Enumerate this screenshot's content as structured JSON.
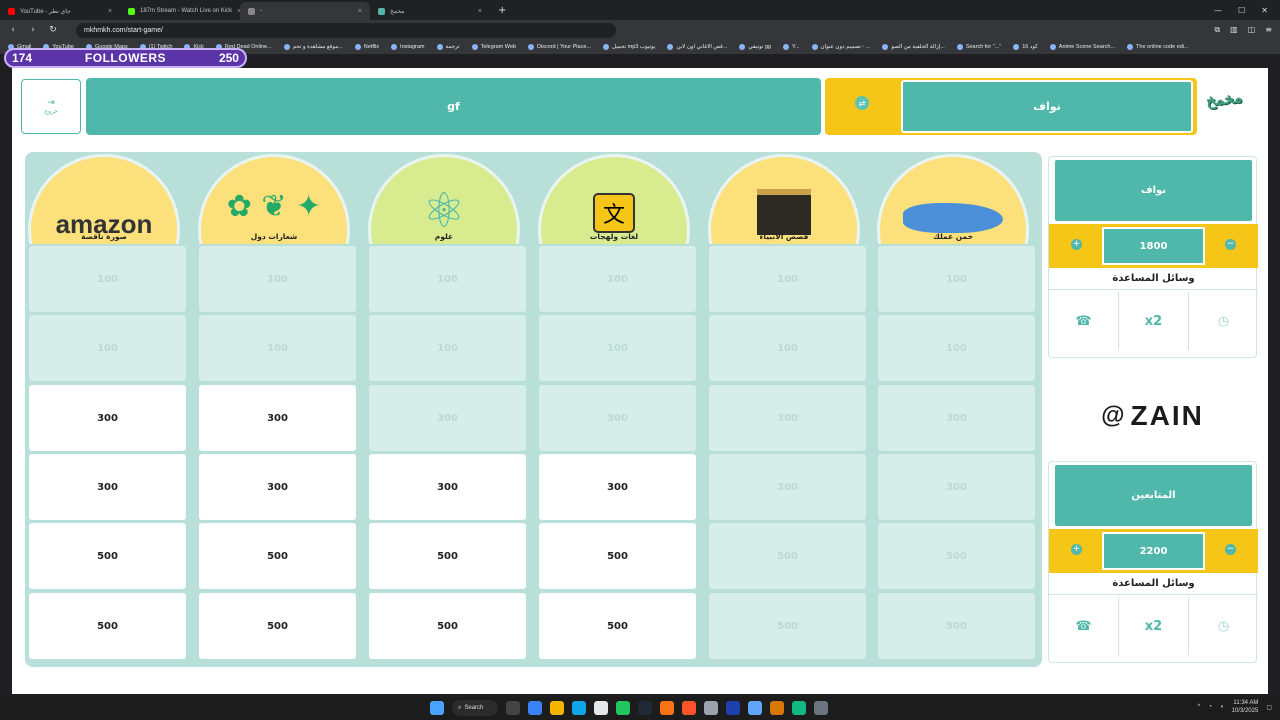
{
  "browser": {
    "tabs": [
      {
        "title": "YouTube - جاي نطر",
        "color": "#ff0000",
        "active": false
      },
      {
        "title": "187m Stream - Watch Live on Kick",
        "color": "#53fc18",
        "active": false
      },
      {
        "title": "-",
        "color": "#888888",
        "active": true
      },
      {
        "title": "مخمخ",
        "color": "#4fb8aa",
        "active": false
      }
    ],
    "url": "mkhmkh.com/start-game/",
    "bookmarks": [
      "Gmail",
      "YouTube",
      "Google Maps",
      "(1) Twitch",
      "Kick",
      "Red Dead Online...",
      "موقع مشاهدة و تحم...",
      "Netflix",
      "Instagram",
      "ترجمة",
      "Telegram Web",
      "Discord | Your Place...",
      "تحميل mp3 يوتيوب",
      "قص الاغاني اون لاين...",
      "توتيقي gg",
      "Y...",
      "تصميم دون عنوان - ...",
      "إزالة الخلفية من الصو...",
      "Search for \"...\"",
      "كود 16",
      "Anime Scene Search...",
      "The online code edi..."
    ]
  },
  "overlay": {
    "left": "174",
    "label": "FOLLOWERS",
    "right": "250"
  },
  "header": {
    "exit_label": "خروج",
    "team_bar": "gf",
    "current_turn": "نواف",
    "logo": "مخمخ"
  },
  "categories": [
    {
      "name": "صورة ناقصة",
      "art": "amazon",
      "cells": [
        {
          "value": "100",
          "active": false
        },
        {
          "value": "100",
          "active": false
        },
        {
          "value": "300",
          "active": true
        },
        {
          "value": "300",
          "active": true
        },
        {
          "value": "500",
          "active": true
        },
        {
          "value": "500",
          "active": true
        }
      ]
    },
    {
      "name": "شعارات دول",
      "art": "flags",
      "cells": [
        {
          "value": "100",
          "active": false
        },
        {
          "value": "100",
          "active": false
        },
        {
          "value": "300",
          "active": true
        },
        {
          "value": "300",
          "active": true
        },
        {
          "value": "500",
          "active": true
        },
        {
          "value": "500",
          "active": true
        }
      ]
    },
    {
      "name": "علوم",
      "art": "atom",
      "cells": [
        {
          "value": "100",
          "active": false
        },
        {
          "value": "100",
          "active": false
        },
        {
          "value": "300",
          "active": false
        },
        {
          "value": "300",
          "active": true
        },
        {
          "value": "500",
          "active": true
        },
        {
          "value": "500",
          "active": true
        }
      ]
    },
    {
      "name": "لغات ولهجات",
      "art": "language",
      "cells": [
        {
          "value": "100",
          "active": false
        },
        {
          "value": "100",
          "active": false
        },
        {
          "value": "300",
          "active": false
        },
        {
          "value": "300",
          "active": true
        },
        {
          "value": "500",
          "active": true
        },
        {
          "value": "500",
          "active": true
        }
      ]
    },
    {
      "name": "قصص الانبياء",
      "art": "kaaba",
      "cells": [
        {
          "value": "100",
          "active": false
        },
        {
          "value": "100",
          "active": false
        },
        {
          "value": "300",
          "active": false
        },
        {
          "value": "300",
          "active": false
        },
        {
          "value": "500",
          "active": false
        },
        {
          "value": "500",
          "active": false
        }
      ]
    },
    {
      "name": "خمن عملك",
      "art": "map",
      "cells": [
        {
          "value": "100",
          "active": false
        },
        {
          "value": "100",
          "active": false
        },
        {
          "value": "300",
          "active": false
        },
        {
          "value": "300",
          "active": false
        },
        {
          "value": "500",
          "active": false
        },
        {
          "value": "500",
          "active": false
        }
      ]
    }
  ],
  "teams": [
    {
      "name": "نواف",
      "score": "1800",
      "help_title": "وسائل المساعدة",
      "help": [
        "call-friend-icon",
        "double-points-icon",
        "timer-icon"
      ],
      "help_text": [
        "",
        "x2",
        ""
      ]
    },
    {
      "name": "المتابعين",
      "score": "2200",
      "help_title": "وسائل المساعدة",
      "help": [
        "call-friend-icon",
        "double-points-icon",
        "timer-icon"
      ],
      "help_text": [
        "",
        "x2",
        ""
      ]
    }
  ],
  "sponsor": "ZAIN",
  "colors": {
    "teal": "#4fb8aa",
    "yellow": "#f5c518",
    "board": "#b9e0d8",
    "disabled_cell": "#d6ede8"
  },
  "taskbar": {
    "search": "Search",
    "time": "11:34 AM",
    "date": "10/3/2025"
  }
}
